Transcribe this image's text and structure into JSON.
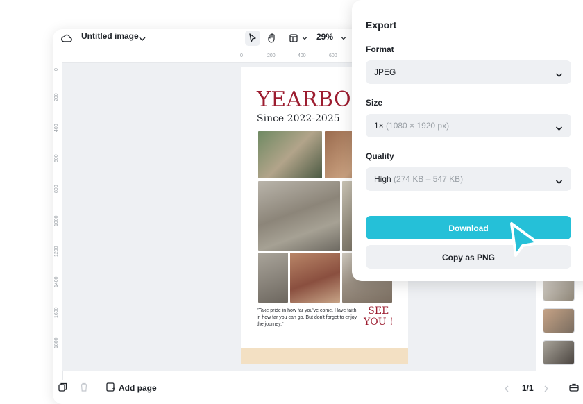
{
  "toolbar": {
    "title": "Untitled image",
    "zoom": "29%"
  },
  "ruler": {
    "h_ticks": [
      "0",
      "200",
      "400",
      "600"
    ],
    "v_ticks": [
      "0",
      "200",
      "400",
      "600",
      "800",
      "1000",
      "1200",
      "1400",
      "1600",
      "1800"
    ]
  },
  "poster": {
    "title": "YEARBOO",
    "subtitle": "Since 2022-2025",
    "quote": "\"Take pride in how far you've come. Have faith in how far you can go. But don't forget to enjoy the journey.\"",
    "see_line1": "SEE",
    "see_line2": "YOU !"
  },
  "bottombar": {
    "add_page": "Add page",
    "page_indicator": "1/1"
  },
  "export": {
    "title": "Export",
    "format_label": "Format",
    "format_value": "JPEG",
    "size_label": "Size",
    "size_value": "1×",
    "size_detail": "(1080 × 1920 px)",
    "quality_label": "Quality",
    "quality_value": "High",
    "quality_detail": "(274 KB – 547 KB)",
    "download_label": "Download",
    "copy_label": "Copy as PNG"
  },
  "colors": {
    "accent": "#25c0d8",
    "poster_red": "#9c1c2f",
    "canvas_bg": "#eef0f3"
  }
}
